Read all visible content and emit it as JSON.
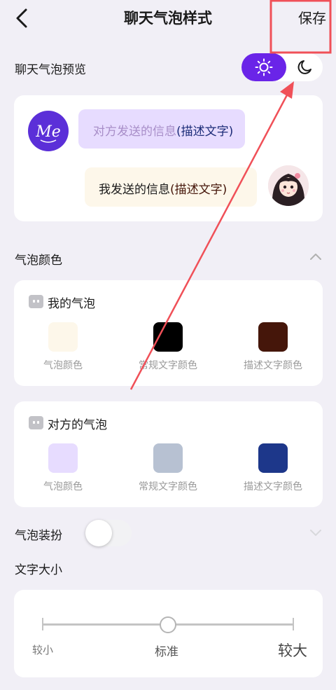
{
  "header": {
    "title": "聊天气泡样式",
    "save_label": "保存"
  },
  "preview": {
    "label": "聊天气泡预览",
    "other_bubble": {
      "text": "对方发送的信息",
      "desc": "(描述文字)"
    },
    "my_bubble": {
      "text": "我发送的信息",
      "desc": "(描述文字)"
    },
    "avatar_other_text": "Me"
  },
  "colors_section": {
    "label": "气泡颜色",
    "mine": {
      "title": "我的气泡",
      "swatches": [
        {
          "label": "气泡颜色",
          "color": "#fdf7ea"
        },
        {
          "label": "常规文字颜色",
          "color": "#000000"
        },
        {
          "label": "描述文字颜色",
          "color": "#45160a"
        }
      ]
    },
    "other": {
      "title": "对方的气泡",
      "swatches": [
        {
          "label": "气泡颜色",
          "color": "#e7dcff"
        },
        {
          "label": "常规文字颜色",
          "color": "#b7c1d2"
        },
        {
          "label": "描述文字颜色",
          "color": "#1d378a"
        }
      ]
    }
  },
  "decor": {
    "label": "气泡装扮",
    "enabled": false
  },
  "font_size": {
    "label": "文字大小",
    "small": "较小",
    "standard": "标准",
    "large": "较大"
  },
  "theme": {
    "accent": "#6a24e8",
    "annotation": "#f05058"
  }
}
